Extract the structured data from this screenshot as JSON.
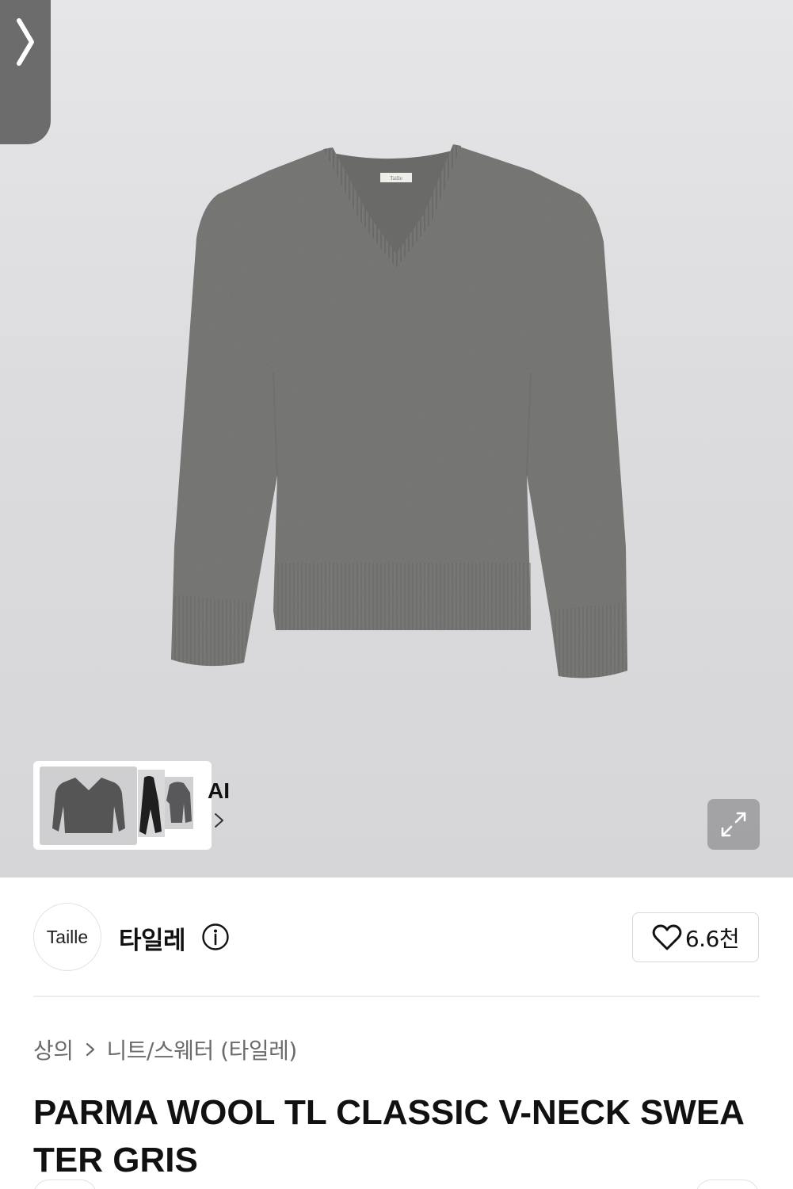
{
  "hero": {
    "side_tab_icon": "chevron-right-icon",
    "product_image_alt": "Grey V-neck wool sweater",
    "thumbnails": {
      "ai_label": "AI",
      "chevron_icon": "chevron-right-icon"
    },
    "expand_icon": "expand-arrows-icon"
  },
  "brand": {
    "logo_text": "Taille",
    "name": "타일레",
    "info_icon": "info-icon",
    "like_icon": "heart-outline-icon",
    "like_count": "6.6천"
  },
  "breadcrumb": {
    "level1": "상의",
    "separator_icon": "chevron-right-icon",
    "level2": "니트/스웨터 (타일레)"
  },
  "product": {
    "title": "PARMA WOOL TL CLASSIC V-NECK SWEATER GRIS"
  },
  "colors": {
    "hero_bg": "#dcdcde",
    "sweater": "#7a7a78",
    "side_tab": "#6c6c6c"
  }
}
